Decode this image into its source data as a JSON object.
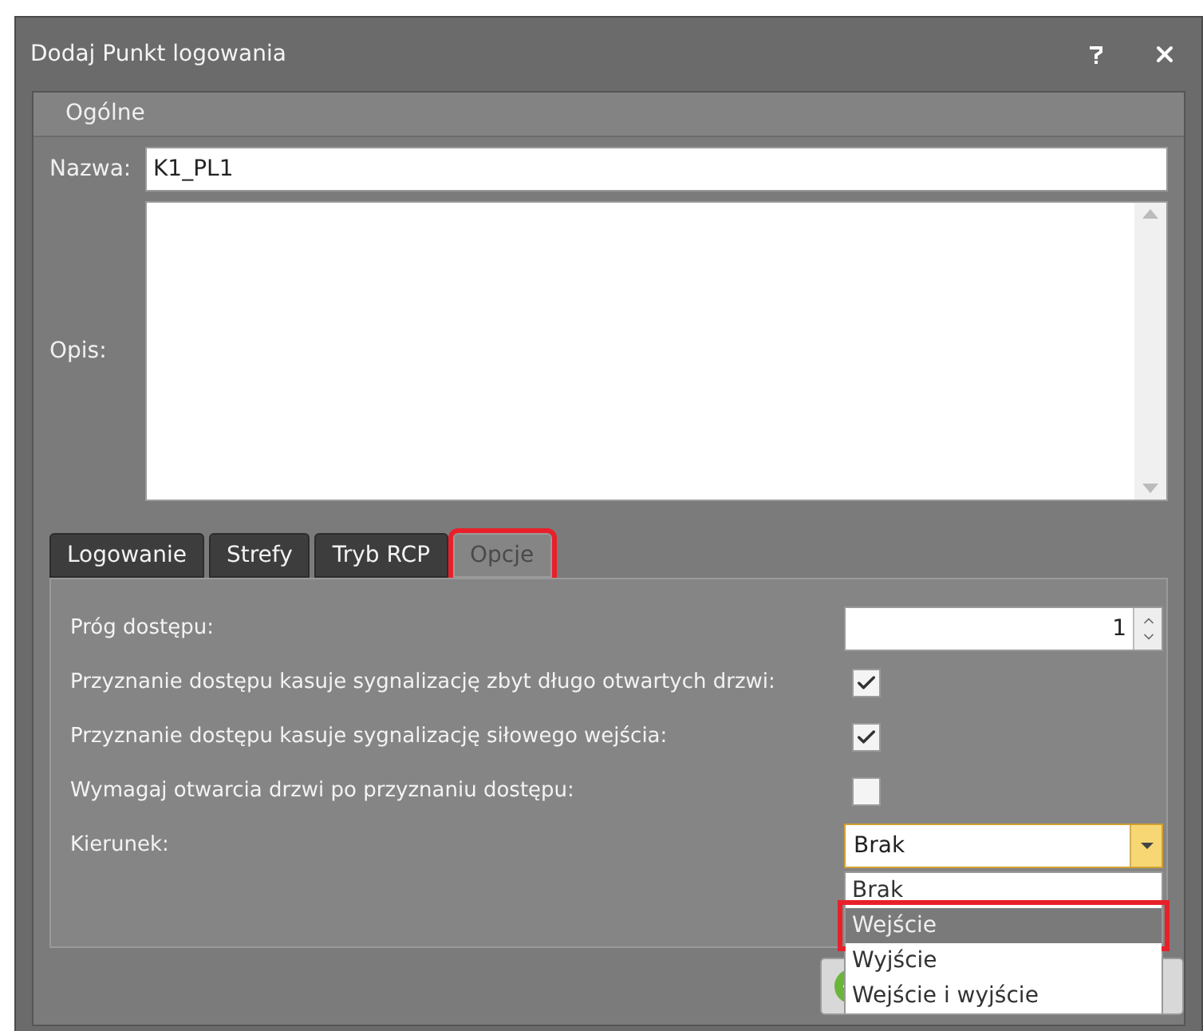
{
  "window": {
    "title": "Dodaj Punkt logowania"
  },
  "group": {
    "title": "Ogólne",
    "name_field": {
      "label": "Nazwa:",
      "value": "K1_PL1"
    },
    "description_field": {
      "label": "Opis:"
    }
  },
  "tabs": [
    {
      "label": "Logowanie",
      "selected": false,
      "highlighted": false
    },
    {
      "label": "Strefy",
      "selected": false,
      "highlighted": false
    },
    {
      "label": "Tryb RCP",
      "selected": false,
      "highlighted": false
    },
    {
      "label": "Opcje",
      "selected": true,
      "highlighted": true
    }
  ],
  "options": [
    {
      "kind": "spinner",
      "label": "Próg dostępu:",
      "value": "1"
    },
    {
      "kind": "checkbox",
      "label": "Przyznanie dostępu kasuje sygnalizację zbyt długo otwartych drzwi:",
      "checked": true
    },
    {
      "kind": "checkbox",
      "label": "Przyznanie dostępu kasuje sygnalizację siłowego wejścia:",
      "checked": true
    },
    {
      "kind": "checkbox",
      "label": "Wymagaj otwarcia drzwi po przyznaniu dostępu:",
      "checked": false
    },
    {
      "kind": "dropdown",
      "label": "Kierunek:",
      "value": "Brak",
      "expanded": true,
      "items": [
        {
          "label": "Brak",
          "hovered": false,
          "highlighted": false
        },
        {
          "label": "Wejście",
          "hovered": true,
          "highlighted": true
        },
        {
          "label": "Wyjście",
          "hovered": false,
          "highlighted": false
        },
        {
          "label": "Wejście i wyjście",
          "hovered": false,
          "highlighted": false
        }
      ]
    }
  ]
}
